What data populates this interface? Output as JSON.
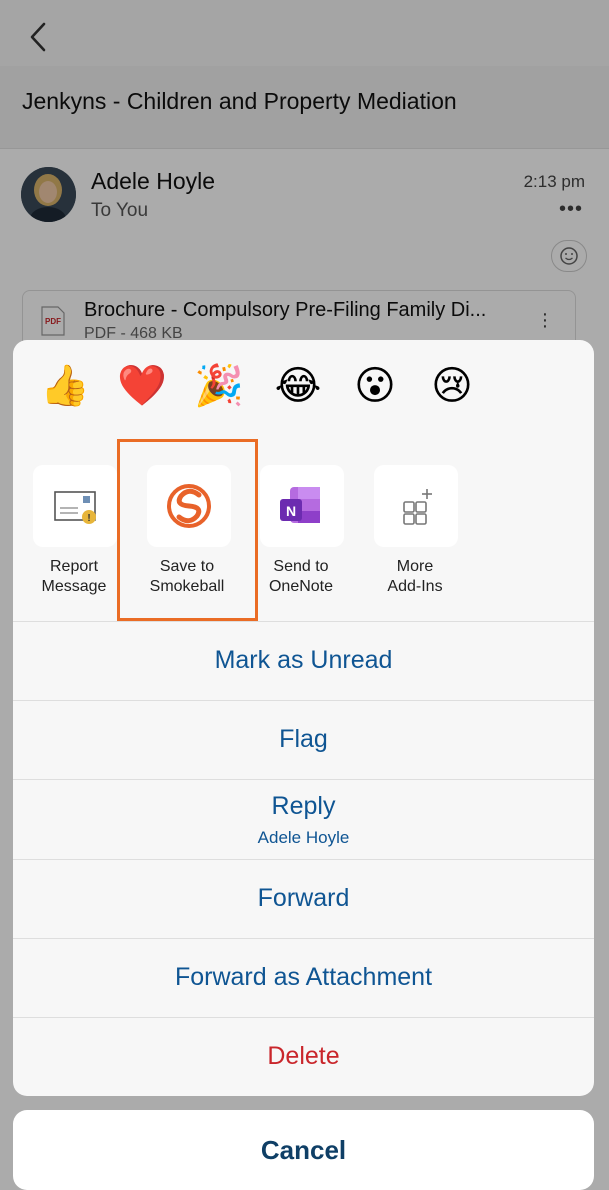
{
  "email": {
    "subject": "Jenkyns - Children and Property Mediation",
    "sender_name": "Adele Hoyle",
    "recipient": "To You",
    "time": "2:13 pm",
    "attachment": {
      "name": "Brochure - Compulsory Pre-Filing Family Di...",
      "meta": "PDF - 468 KB",
      "type_label": "PDF"
    }
  },
  "reactions": [
    {
      "name": "thumbs-up",
      "glyph": "👍"
    },
    {
      "name": "heart",
      "glyph": "❤️"
    },
    {
      "name": "party-popper",
      "glyph": "🎉"
    },
    {
      "name": "laughing",
      "glyph": "😂"
    },
    {
      "name": "surprised",
      "glyph": "😮"
    },
    {
      "name": "sad",
      "glyph": "😢"
    }
  ],
  "addins": {
    "report": {
      "line1": "Report",
      "line2": "Message"
    },
    "smokeball": {
      "line1": "Save to",
      "line2": "Smokeball"
    },
    "onenote": {
      "line1": "Send to",
      "line2": "OneNote"
    },
    "more": {
      "line1": "More",
      "line2": "Add-Ins"
    }
  },
  "actions": {
    "mark_unread": "Mark as Unread",
    "flag": "Flag",
    "reply": "Reply",
    "reply_sub": "Adele Hoyle",
    "forward": "Forward",
    "forward_attachment": "Forward as Attachment",
    "delete": "Delete",
    "cancel": "Cancel"
  },
  "colors": {
    "action_blue": "#0f5593",
    "delete_red": "#c9262b",
    "highlight_orange": "#ea6c25",
    "smokeball_orange": "#e8622a",
    "onenote_purple": "#7b3fb8"
  }
}
